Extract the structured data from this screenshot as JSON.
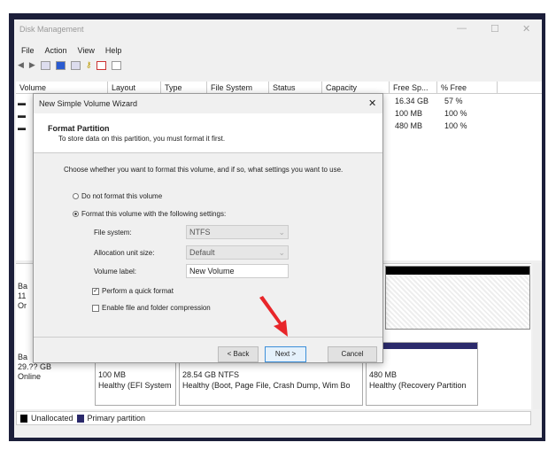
{
  "window": {
    "title": "Disk Management",
    "minimize": "—",
    "maximize": "☐",
    "close": "✕"
  },
  "menu": [
    "File",
    "Action",
    "View",
    "Help"
  ],
  "columns": [
    "Volume",
    "Layout",
    "Type",
    "File System",
    "Status",
    "Capacity",
    "Free Sp...",
    "% Free"
  ],
  "rows": [
    {
      "free": "16.34 GB",
      "pct": "57 %"
    },
    {
      "free": "100 MB",
      "pct": "100 %"
    },
    {
      "free": "480 MB",
      "pct": "100 %"
    }
  ],
  "disk1": {
    "l1": "Ba",
    "l2": "11",
    "l3": "Or"
  },
  "disk0": {
    "l1": "Ba",
    "l2": "29.?? GB",
    "l3": "Online",
    "parts": [
      {
        "size": "100 MB",
        "status": "Healthy (EFI System"
      },
      {
        "size": "28.54 GB NTFS",
        "status": "Healthy (Boot, Page File, Crash Dump, Wim Bo"
      },
      {
        "size": "480 MB",
        "status": "Healthy (Recovery Partition"
      }
    ]
  },
  "legend": {
    "unallocated": "Unallocated",
    "primary": "Primary partition",
    "colors": {
      "unallocated": "#000000",
      "primary": "#2b2a6b"
    }
  },
  "wizard": {
    "title": "New Simple Volume Wizard",
    "close": "✕",
    "heading": "Format Partition",
    "subheading": "To store data on this partition, you must format it first.",
    "prompt": "Choose whether you want to format this volume, and if so, what settings you want to use.",
    "opt_no": "Do not format this volume",
    "opt_yes": "Format this volume with the following settings:",
    "fs_label": "File system:",
    "fs_value": "NTFS",
    "alloc_label": "Allocation unit size:",
    "alloc_value": "Default",
    "vol_label": "Volume label:",
    "vol_value": "New Volume",
    "quick": "Perform a quick format",
    "compress": "Enable file and folder compression",
    "back": "< Back",
    "next": "Next >",
    "cancel": "Cancel"
  }
}
